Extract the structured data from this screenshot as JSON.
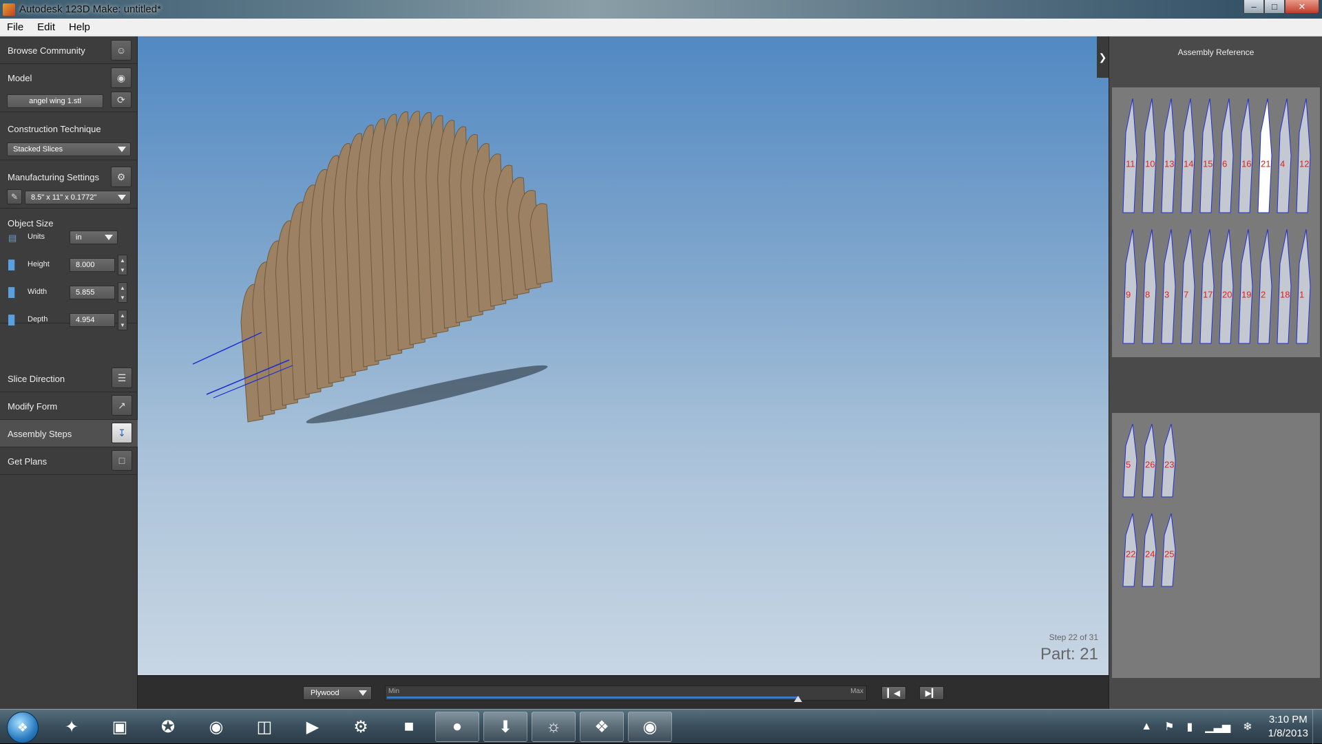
{
  "window": {
    "title": "Autodesk 123D Make: untitled*"
  },
  "menu": [
    "File",
    "Edit",
    "Help"
  ],
  "left_panel": {
    "browse_community": "Browse Community",
    "model_title": "Model",
    "model_file": "angel wing 1.stl",
    "construction_title": "Construction Technique",
    "construction_value": "Stacked Slices",
    "manufacturing_title": "Manufacturing Settings",
    "manufacturing_value": "8.5\" x 11\" x 0.1772\"",
    "object_size_title": "Object Size",
    "units_label": "Units",
    "units_value": "in",
    "height_label": "Height",
    "height_value": "8.000",
    "width_label": "Width",
    "width_value": "5.855",
    "depth_label": "Depth",
    "depth_value": "4.954",
    "slice_direction": "Slice Direction",
    "modify_form": "Modify Form",
    "assembly_steps": "Assembly Steps",
    "get_plans": "Get Plans"
  },
  "viewport": {
    "step_text": "Step 22 of 31",
    "part_text": "Part: 21"
  },
  "bottom_bar": {
    "material": "Plywood",
    "slider_min": "Min",
    "slider_max": "Max",
    "slider_position_fraction": 0.86,
    "prev_icon": "step-back-icon",
    "next_icon": "step-forward-icon"
  },
  "right_panel": {
    "title": "Assembly Reference",
    "sheet1_labels": [
      "11",
      "10",
      "13",
      "14",
      "15",
      "6",
      "16",
      "21",
      "4",
      "12",
      "9",
      "8",
      "3",
      "7",
      "17",
      "20",
      "19",
      "2",
      "18",
      "1"
    ],
    "sheet2_labels": [
      "5",
      "26",
      "23",
      "22",
      "24",
      "25"
    ]
  },
  "taskbar": {
    "time": "3:10 PM",
    "date": "1/8/2013"
  },
  "colors": {
    "panel_bg": "#3d3d3d",
    "viewport_top": "#5189c3",
    "viewport_bottom": "#c8d6e4",
    "accent": "#3a7bc8",
    "wood": "#9c8262"
  }
}
